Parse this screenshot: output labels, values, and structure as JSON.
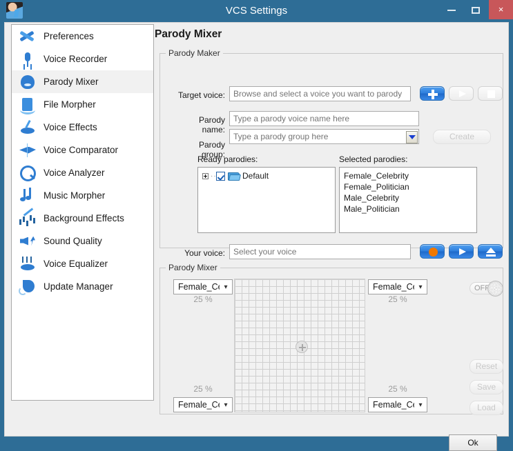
{
  "window": {
    "title": "VCS Settings",
    "app_icon": "avatar-icon",
    "minimize_label": "minimize-icon",
    "maximize_label": "maximize-icon",
    "close_label": "×",
    "titlebar_color": "#2e6d96",
    "close_color": "#c8575a"
  },
  "sidebar": {
    "items": [
      {
        "label": "Preferences",
        "icon": "wrench-screwdriver-icon",
        "selected": false
      },
      {
        "label": "Voice Recorder",
        "icon": "microphone-icon",
        "selected": false
      },
      {
        "label": "Parody Mixer",
        "icon": "head-speech-icon",
        "selected": true
      },
      {
        "label": "File Morpher",
        "icon": "file-refresh-icon",
        "selected": false
      },
      {
        "label": "Voice Effects",
        "icon": "lips-wand-icon",
        "selected": false
      },
      {
        "label": "Voice Comparator",
        "icon": "comparator-icon",
        "selected": false
      },
      {
        "label": "Voice Analyzer",
        "icon": "magnifier-wave-icon",
        "selected": false
      },
      {
        "label": "Music Morpher",
        "icon": "music-note-icon",
        "selected": false
      },
      {
        "label": "Background Effects",
        "icon": "wand-equalizer-icon",
        "selected": false
      },
      {
        "label": "Sound Quality",
        "icon": "speaker-bolt-icon",
        "selected": false
      },
      {
        "label": "Voice Equalizer",
        "icon": "lips-sliders-icon",
        "selected": false
      },
      {
        "label": "Update Manager",
        "icon": "update-speech-icon",
        "selected": false
      }
    ]
  },
  "page": {
    "title": "Parody Mixer"
  },
  "parody_maker": {
    "legend": "Parody Maker",
    "target_voice": {
      "label": "Target voice:",
      "value": "",
      "placeholder": "Browse and select a voice you want to parody"
    },
    "parody_name": {
      "label": "Parody name:",
      "value": "",
      "placeholder": "Type a parody voice name here"
    },
    "parody_group": {
      "label": "Parody group:",
      "value": "",
      "placeholder": "Type a parody group here"
    },
    "buttons": {
      "add": {
        "label": "add-icon",
        "enabled": true
      },
      "play": {
        "label": "play-icon",
        "enabled": false
      },
      "stop": {
        "label": "stop-icon",
        "enabled": false
      },
      "create": {
        "label": "Create",
        "enabled": false
      }
    },
    "ready_parodies": {
      "label": "Ready parodies:",
      "tree": [
        {
          "label": "Default",
          "checked": true,
          "expandable": true,
          "icon": "folder-icon"
        }
      ]
    },
    "selected_parodies": {
      "label": "Selected parodies:",
      "items": [
        "Female_Celebrity",
        "Female_Politician",
        "Male_Celebrity",
        "Male_Politician"
      ]
    },
    "your_voice": {
      "label": "Your voice:",
      "value": "",
      "placeholder": "Select your voice",
      "buttons": {
        "record": {
          "label": "record-icon",
          "enabled": true
        },
        "play": {
          "label": "play-icon",
          "enabled": true
        },
        "eject": {
          "label": "eject-icon",
          "enabled": true
        }
      }
    }
  },
  "parody_mixer": {
    "legend": "Parody Mixer",
    "corners": [
      {
        "position": "top-left",
        "voice": "Female_Cel",
        "percent": "25 %"
      },
      {
        "position": "top-right",
        "voice": "Female_Cel",
        "percent": "25 %"
      },
      {
        "position": "bottom-left",
        "voice": "Female_Cel",
        "percent": "25 %"
      },
      {
        "position": "bottom-right",
        "voice": "Female_Cel",
        "percent": "25 %"
      }
    ],
    "power_switch": {
      "label": "OFF",
      "state": "off"
    },
    "actions": [
      {
        "label": "Reset",
        "enabled": false
      },
      {
        "label": "Save",
        "enabled": false
      },
      {
        "label": "Load",
        "enabled": false
      }
    ]
  },
  "footer": {
    "ok_label": "Ok"
  }
}
